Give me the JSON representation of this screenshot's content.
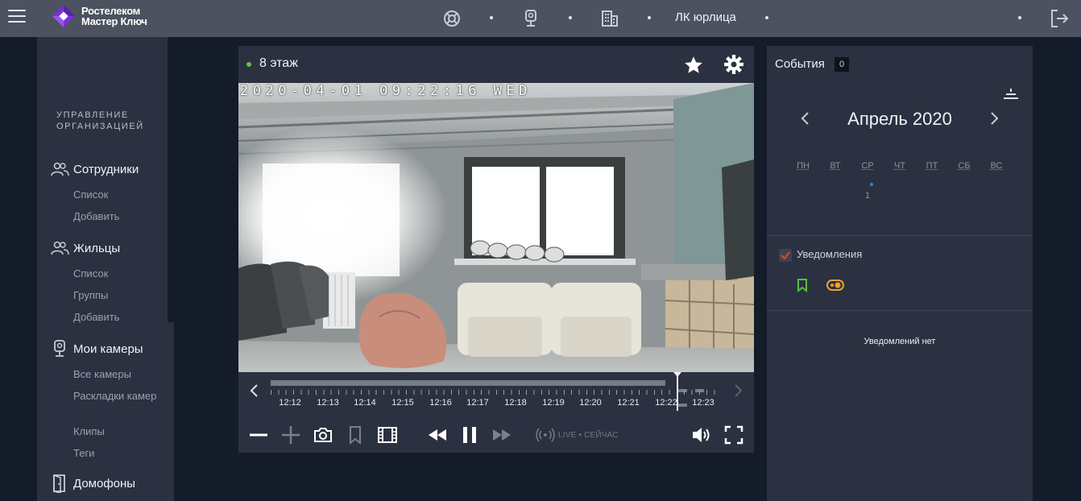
{
  "header": {
    "logo_line1": "Ростелеком",
    "logo_line2": "Мастер Ключ",
    "nav_text": "ЛК юрлица",
    "icons": [
      "menu-icon",
      "lifebuoy-icon",
      "camera-icon",
      "building-icon",
      "logout-icon"
    ]
  },
  "sidebar": {
    "heading": "УПРАВЛЕНИЕ ОРГАНИЗАЦИЕЙ",
    "sections": [
      {
        "label": "Сотрудники",
        "icon": "users-icon",
        "items": [
          "Список",
          "Добавить"
        ]
      },
      {
        "label": "Жильцы",
        "icon": "users-icon",
        "items": [
          "Список",
          "Группы",
          "Добавить"
        ]
      },
      {
        "label": "Мои камеры",
        "icon": "webcam-icon",
        "items": [
          "Все камеры",
          "Раскладки камер",
          "Клипы",
          "Теги"
        ]
      },
      {
        "label": "Домофоны",
        "icon": "door-icon",
        "items": []
      }
    ]
  },
  "camera": {
    "title": "8 этаж",
    "timestamp": "2020-04-01 09:22:16 WED",
    "timeline_labels": [
      "12:12",
      "12:13",
      "12:14",
      "12:15",
      "12:16",
      "12:17",
      "12:18",
      "12:19",
      "12:20",
      "12:21",
      "12:22",
      "12:23"
    ],
    "live_text": "LIVE • СЕЙЧАС",
    "colors": {
      "status": "#62c443"
    }
  },
  "events": {
    "title": "События",
    "count": "0",
    "month": "Апрель 2020",
    "weekdays": [
      "ПН",
      "ВТ",
      "СР",
      "ЧТ",
      "ПТ",
      "СБ",
      "ВС"
    ],
    "day": "1",
    "notifications_label": "Уведомления",
    "empty_text": "Уведомлений нет",
    "colors": {
      "checkbox": "#d9492b",
      "bookmark": "#4fc43f",
      "toggle": "#f0a030"
    }
  }
}
